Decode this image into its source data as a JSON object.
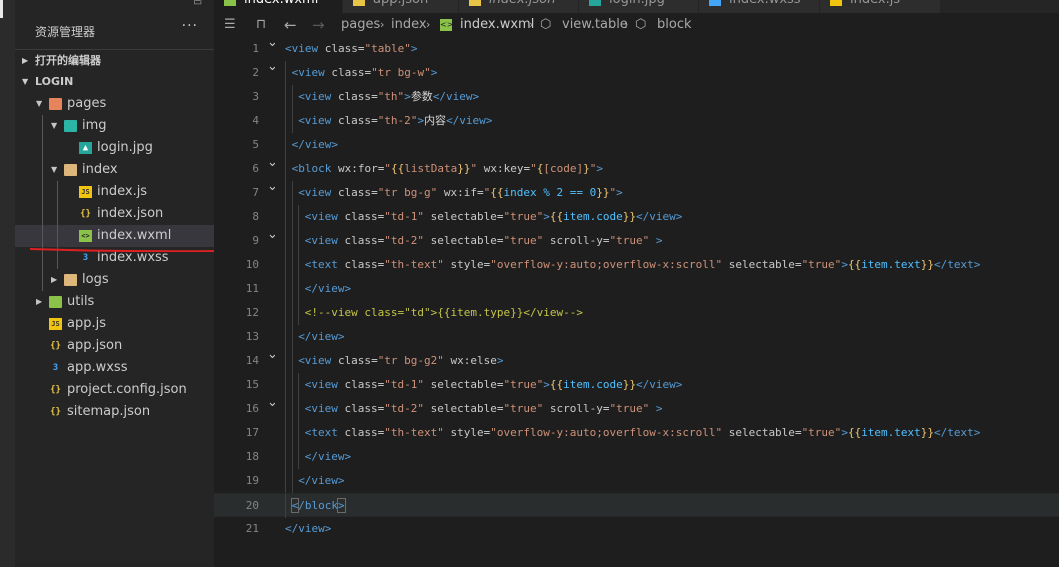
{
  "explorer": {
    "title": "资源管理器",
    "more": "···",
    "open_editors": "打开的编辑器",
    "project": "LOGIN"
  },
  "tree": [
    {
      "name": "pages",
      "type": "folder-orange",
      "depth": 1,
      "expanded": true
    },
    {
      "name": "img",
      "type": "folder-teal",
      "depth": 2,
      "expanded": true
    },
    {
      "name": "login.jpg",
      "type": "image",
      "depth": 3
    },
    {
      "name": "index",
      "type": "folder",
      "depth": 2,
      "expanded": true
    },
    {
      "name": "index.js",
      "type": "js",
      "depth": 3
    },
    {
      "name": "index.json",
      "type": "json",
      "depth": 3
    },
    {
      "name": "index.wxml",
      "type": "wxml",
      "depth": 3,
      "selected": true
    },
    {
      "name": "index.wxss",
      "type": "css",
      "depth": 3
    },
    {
      "name": "logs",
      "type": "folder",
      "depth": 2,
      "expanded": false
    },
    {
      "name": "utils",
      "type": "folder-green",
      "depth": 1,
      "expanded": false
    },
    {
      "name": "app.js",
      "type": "js",
      "depth": 1
    },
    {
      "name": "app.json",
      "type": "json",
      "depth": 1
    },
    {
      "name": "app.wxss",
      "type": "css",
      "depth": 1
    },
    {
      "name": "project.config.json",
      "type": "json",
      "depth": 1
    },
    {
      "name": "sitemap.json",
      "type": "json",
      "depth": 1
    }
  ],
  "tabs": [
    {
      "label": "index.wxml",
      "active": true
    },
    {
      "label": "app.json"
    },
    {
      "label": "index.json"
    },
    {
      "label": "login.jpg"
    },
    {
      "label": "index.wxss"
    },
    {
      "label": "index.js"
    }
  ],
  "breadcrumbs": [
    "pages",
    "index",
    "index.wxml",
    "view.table",
    "block"
  ],
  "code_lines": [
    {
      "n": "1",
      "fold": true,
      "indent": 0,
      "html": "<span class=\"t\">&lt;view</span> <span class=\"a\">class</span>=<span class=\"s\">\"table\"</span><span class=\"t\">&gt;</span>"
    },
    {
      "n": "2",
      "fold": true,
      "indent": 1,
      "html": "<span class=\"t\">&lt;view</span> <span class=\"a\">class</span>=<span class=\"s\">\"tr bg-w\"</span><span class=\"t\">&gt;</span>"
    },
    {
      "n": "3",
      "indent": 2,
      "html": "<span class=\"t\">&lt;view</span> <span class=\"a\">class</span>=<span class=\"s\">\"th\"</span><span class=\"t\">&gt;</span><span class=\"w\">参数</span><span class=\"t\">&lt;/view&gt;</span>"
    },
    {
      "n": "4",
      "indent": 2,
      "html": "<span class=\"t\">&lt;view</span> <span class=\"a\">class</span>=<span class=\"s\">\"th-2\"</span><span class=\"t\">&gt;</span><span class=\"w\">内容</span><span class=\"t\">&lt;/view&gt;</span>"
    },
    {
      "n": "5",
      "indent": 1,
      "html": "<span class=\"t\">&lt;/view&gt;</span>"
    },
    {
      "n": "6",
      "fold": true,
      "indent": 1,
      "html": "<span class=\"t\">&lt;block</span> <span class=\"a\">wx:for</span>=<span class=\"s\">\"</span><span class=\"m\">{{</span><span class=\"s\">listData</span><span class=\"m\">}}</span><span class=\"s\">\"</span> <span class=\"a\">wx:key</span>=<span class=\"s\">\"</span><span class=\"m\">{</span><span class=\"s\">[code]</span><span class=\"m\">}</span><span class=\"s\">\"</span><span class=\"t\">&gt;</span>"
    },
    {
      "n": "7",
      "fold": true,
      "indent": 2,
      "html": "<span class=\"t\">&lt;view</span> <span class=\"a\">class</span>=<span class=\"s\">\"tr bg-g\"</span> <span class=\"a\">wx:if</span>=<span class=\"s\">\"</span><span class=\"m\">{{</span><span class=\"v\">index % 2 == 0</span><span class=\"m\">}}</span><span class=\"s\">\"</span><span class=\"t\">&gt;</span>"
    },
    {
      "n": "8",
      "indent": 3,
      "html": "<span class=\"t\">&lt;view</span> <span class=\"a\">class</span>=<span class=\"s\">\"td-1\"</span> <span class=\"a\">selectable</span>=<span class=\"s\">\"true\"</span><span class=\"t\">&gt;</span><span class=\"m\">{{</span><span class=\"v\">item.code</span><span class=\"m\">}}</span><span class=\"t\">&lt;/view&gt;</span>"
    },
    {
      "n": "9",
      "fold": true,
      "indent": 3,
      "html": "<span class=\"t\">&lt;view</span> <span class=\"a\">class</span>=<span class=\"s\">\"td-2\"</span> <span class=\"a\">selectable</span>=<span class=\"s\">\"true\"</span> <span class=\"a\">scroll-y</span>=<span class=\"s\">\"true\"</span> <span class=\"t\">&gt;</span>"
    },
    {
      "n": "10",
      "indent": 3,
      "html": "<span class=\"t\">&lt;text</span> <span class=\"a\">class</span>=<span class=\"s\">\"th-text\"</span> <span class=\"a\">style</span>=<span class=\"s\">\"overflow-y:auto;overflow-x:scroll\"</span> <span class=\"a\">selectable</span>=<span class=\"s\">\"true\"</span><span class=\"t\">&gt;</span><span class=\"m\">{{</span><span class=\"v\">item.text</span><span class=\"m\">}}</span><span class=\"t\">&lt;/text&gt;</span>"
    },
    {
      "n": "11",
      "indent": 3,
      "html": "<span class=\"t\">&lt;/view&gt;</span>"
    },
    {
      "n": "12",
      "indent": 3,
      "html": "<span class=\"cm\">&lt;!--view class=\"td\"&gt;{{item.type}}&lt;/view--&gt;</span>"
    },
    {
      "n": "13",
      "indent": 2,
      "html": "<span class=\"t\">&lt;/view&gt;</span>"
    },
    {
      "n": "14",
      "fold": true,
      "indent": 2,
      "html": "<span class=\"t\">&lt;view</span> <span class=\"a\">class</span>=<span class=\"s\">\"tr bg-g2\"</span> <span class=\"a\">wx:else</span><span class=\"t\">&gt;</span>"
    },
    {
      "n": "15",
      "indent": 3,
      "html": "<span class=\"t\">&lt;view</span> <span class=\"a\">class</span>=<span class=\"s\">\"td-1\"</span> <span class=\"a\">selectable</span>=<span class=\"s\">\"true\"</span><span class=\"t\">&gt;</span><span class=\"m\">{{</span><span class=\"v\">item.code</span><span class=\"m\">}}</span><span class=\"t\">&lt;/view&gt;</span>"
    },
    {
      "n": "16",
      "fold": true,
      "indent": 3,
      "html": "<span class=\"t\">&lt;view</span> <span class=\"a\">class</span>=<span class=\"s\">\"td-2\"</span> <span class=\"a\">selectable</span>=<span class=\"s\">\"true\"</span> <span class=\"a\">scroll-y</span>=<span class=\"s\">\"true\"</span> <span class=\"t\">&gt;</span>"
    },
    {
      "n": "17",
      "indent": 3,
      "html": "<span class=\"t\">&lt;text</span> <span class=\"a\">class</span>=<span class=\"s\">\"th-text\"</span> <span class=\"a\">style</span>=<span class=\"s\">\"overflow-y:auto;overflow-x:scroll\"</span> <span class=\"a\">selectable</span>=<span class=\"s\">\"true\"</span><span class=\"t\">&gt;</span><span class=\"m\">{{</span><span class=\"v\">item.text</span><span class=\"m\">}}</span><span class=\"t\">&lt;/text&gt;</span>"
    },
    {
      "n": "18",
      "indent": 3,
      "html": "<span class=\"t\">&lt;/view&gt;</span>"
    },
    {
      "n": "19",
      "indent": 2,
      "html": "<span class=\"t\">&lt;/view&gt;</span>"
    },
    {
      "n": "20",
      "indent": 1,
      "highlight": true,
      "html": "<span class=\"t bracket\">&lt;</span><span class=\"t\">/block</span><span class=\"t bracket\">&gt;</span>"
    },
    {
      "n": "21",
      "indent": 0,
      "html": "<span class=\"t\">&lt;/view&gt;</span>"
    }
  ]
}
